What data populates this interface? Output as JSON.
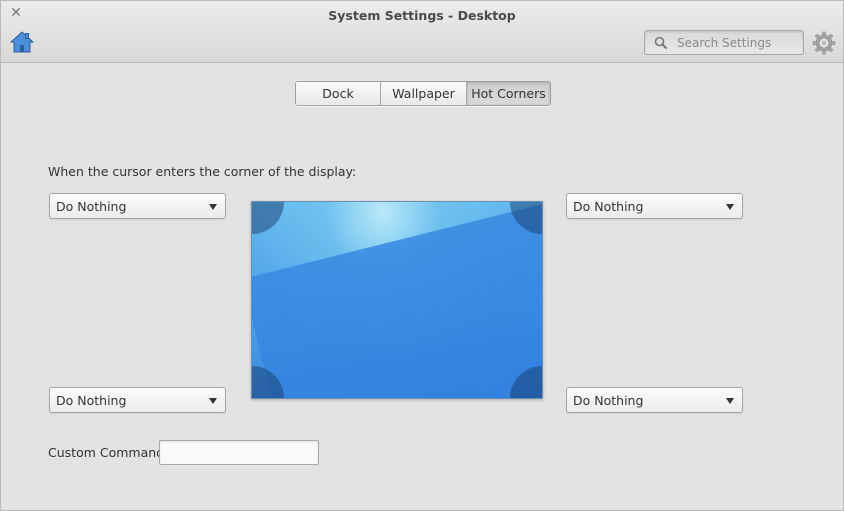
{
  "window": {
    "title": "System Settings - Desktop",
    "close_glyph": "✕"
  },
  "header": {
    "home_icon": "home-icon",
    "search": {
      "placeholder": "Search Settings",
      "value": ""
    },
    "settings_icon": "gear-icon"
  },
  "tabs": [
    {
      "label": "Dock",
      "active": false
    },
    {
      "label": "Wallpaper",
      "active": false
    },
    {
      "label": "Hot Corners",
      "active": true
    }
  ],
  "hot_corners": {
    "instruction": "When the cursor enters the corner of the display:",
    "top_left": "Do Nothing",
    "top_right": "Do Nothing",
    "bottom_left": "Do Nothing",
    "bottom_right": "Do Nothing"
  },
  "custom_command": {
    "label": "Custom Command:",
    "value": ""
  },
  "colors": {
    "accent_blue": "#3a8ae0",
    "window_bg": "#e3e3e3"
  }
}
